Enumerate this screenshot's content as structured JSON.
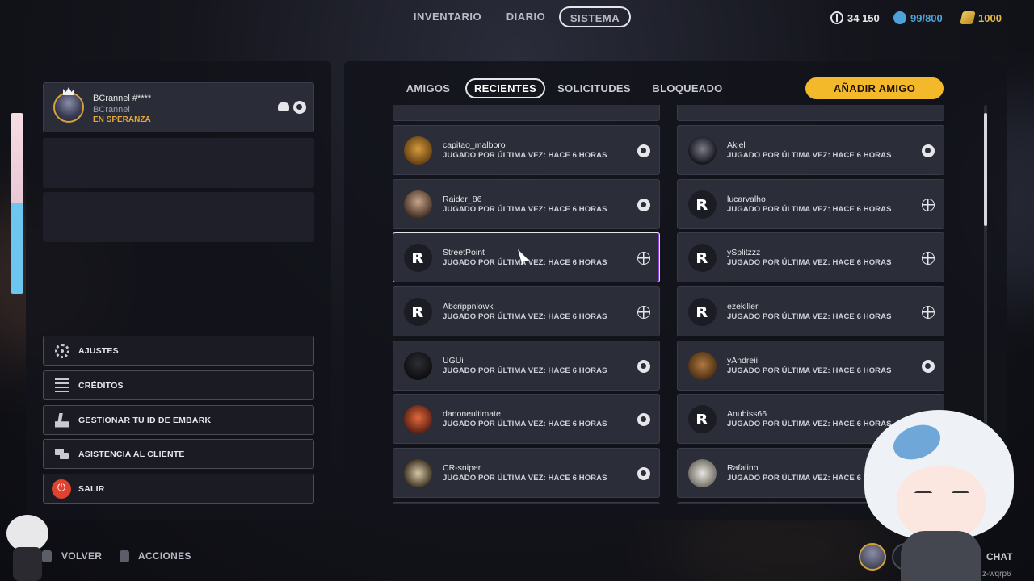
{
  "topnav": {
    "tabs": [
      {
        "label": "INVENTARIO",
        "active": false
      },
      {
        "label": "DIARIO",
        "active": false
      },
      {
        "label": "SISTEMA",
        "active": true
      }
    ],
    "currencies": [
      {
        "icon": "vres-icon",
        "value": "34 150",
        "color": "#e6e6ea"
      },
      {
        "icon": "multibucks-icon",
        "value": "99/800",
        "color": "#4da3d9"
      },
      {
        "icon": "gold-bars-icon",
        "value": "1000",
        "color": "#e6b84a"
      }
    ]
  },
  "profile": {
    "name": "BCrannel #****",
    "sub": "BCrannel",
    "status": "EN SPERANZA",
    "status_color": "#e6a83a",
    "platform_icons": [
      "discord-icon",
      "steam-icon"
    ]
  },
  "menu": [
    {
      "label": "AJUSTES",
      "icon": "gear-icon"
    },
    {
      "label": "CRÉDITOS",
      "icon": "list-icon"
    },
    {
      "label": "GESTIONAR TU ID DE EMBARK",
      "icon": "id-card-icon"
    },
    {
      "label": "ASISTENCIA AL CLIENTE",
      "icon": "chat-bubbles-icon"
    },
    {
      "label": "SALIR",
      "icon": "power-icon"
    }
  ],
  "bottom": {
    "back_label": "VOLVER",
    "actions_label": "ACCIONES",
    "chat_label": "CHAT",
    "tag": "z-wqrp6"
  },
  "friends_tabs": [
    {
      "label": "AMIGOS",
      "active": false
    },
    {
      "label": "RECIENTES",
      "active": true
    },
    {
      "label": "SOLICITUDES",
      "active": false
    },
    {
      "label": "BLOQUEADO",
      "active": false
    }
  ],
  "add_friend_label": "AÑADIR AMIGO",
  "accent_color": "#f4b92b",
  "friends_left": [
    {
      "name": "capitao_malboro",
      "last": "JUGADO POR ÚLTIMA VEZ: HACE 6 HORAS",
      "platform": "steam-icon"
    },
    {
      "name": "Raider_86",
      "last": "JUGADO POR ÚLTIMA VEZ: HACE 6 HORAS",
      "platform": "steam-icon"
    },
    {
      "name": "StreetPoint",
      "last": "JUGADO POR ÚLTIMA VEZ: HACE 6 HORAS",
      "platform": "globe-icon"
    },
    {
      "name": "Abcrippnlowk",
      "last": "JUGADO POR ÚLTIMA VEZ: HACE 6 HORAS",
      "platform": "globe-icon"
    },
    {
      "name": "UGUi",
      "last": "JUGADO POR ÚLTIMA VEZ: HACE 6 HORAS",
      "platform": "steam-icon"
    },
    {
      "name": "danoneultimate",
      "last": "JUGADO POR ÚLTIMA VEZ: HACE 6 HORAS",
      "platform": "steam-icon"
    },
    {
      "name": "CR-sniper",
      "last": "JUGADO POR ÚLTIMA VEZ: HACE 6 HORAS",
      "platform": "steam-icon"
    }
  ],
  "friends_right": [
    {
      "name": "Akiel",
      "last": "JUGADO POR ÚLTIMA VEZ: HACE 6 HORAS",
      "platform": "steam-icon"
    },
    {
      "name": "lucarvalho",
      "last": "JUGADO POR ÚLTIMA VEZ: HACE 6 HORAS",
      "platform": "globe-icon"
    },
    {
      "name": "ySplitzzz",
      "last": "JUGADO POR ÚLTIMA VEZ: HACE 6 HORAS",
      "platform": "globe-icon"
    },
    {
      "name": "ezekiller",
      "last": "JUGADO POR ÚLTIMA VEZ: HACE 6 HORAS",
      "platform": "globe-icon"
    },
    {
      "name": "yAndreii",
      "last": "JUGADO POR ÚLTIMA VEZ: HACE 6 HORAS",
      "platform": "steam-icon"
    },
    {
      "name": "Anubiss66",
      "last": "JUGADO POR ÚLTIMA VEZ: HACE 6 HORAS",
      "platform": "steam-icon"
    },
    {
      "name": "Rafalino",
      "last": "JUGADO POR ÚLTIMA VEZ: HACE 6 HORAS",
      "platform": "steam-icon"
    }
  ]
}
